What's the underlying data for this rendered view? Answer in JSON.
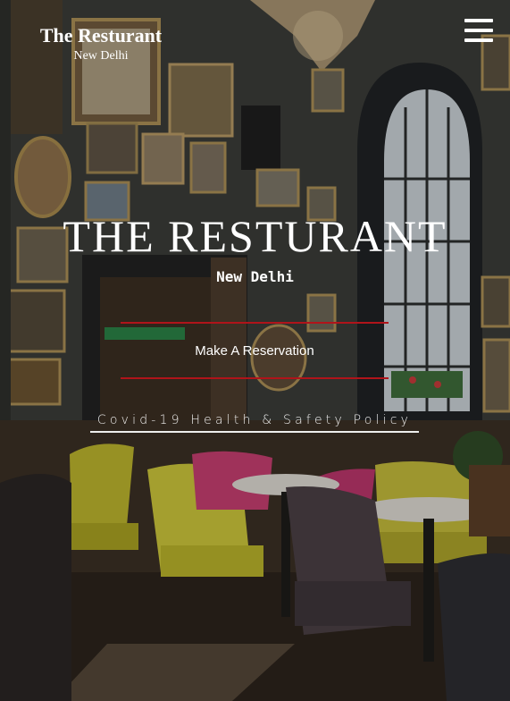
{
  "header": {
    "brand_title": "The Resturant",
    "brand_subtitle": "New Delhi",
    "menu_icon": "hamburger-menu-icon"
  },
  "hero": {
    "title": "THE RESTURANT",
    "subtitle": "New Delhi",
    "reservation_label": "Make A Reservation",
    "covid_link_label": "Covid-19 Health & Safety Policy",
    "accent_color": "#b0141a",
    "background_image": "restaurant-interior-photo"
  }
}
